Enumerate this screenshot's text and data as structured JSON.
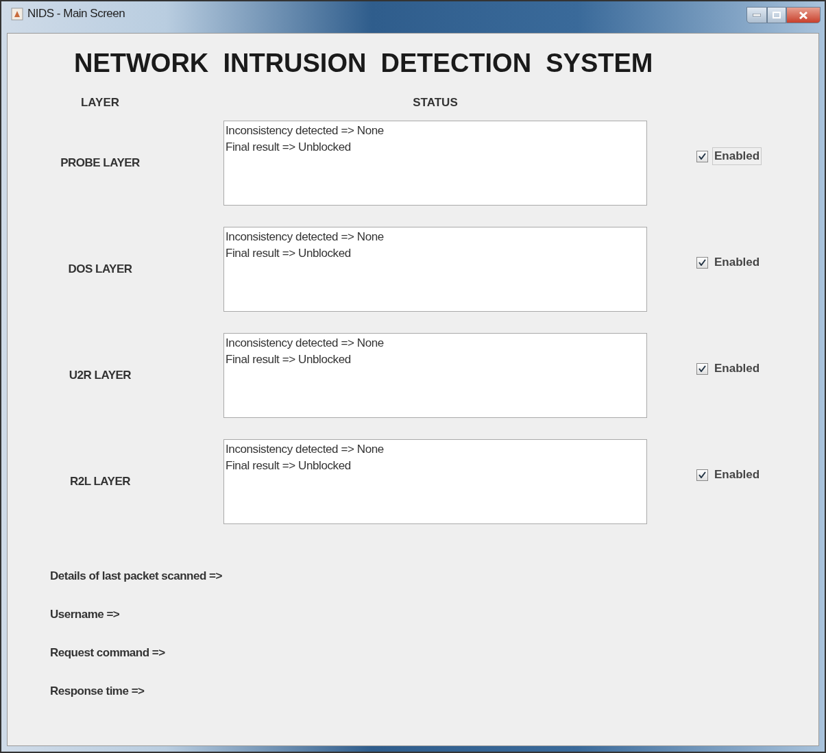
{
  "window": {
    "title": "NIDS - Main Screen"
  },
  "heading": "NETWORK  INTRUSION  DETECTION  SYSTEM",
  "columns": {
    "layer": "LAYER",
    "status": "STATUS"
  },
  "layers": [
    {
      "name": "PROBE LAYER",
      "status_lines": [
        "Inconsistency detected => None",
        "Final result => Unblocked"
      ],
      "checkbox": {
        "label": "Enabled",
        "checked": true,
        "focused": true
      }
    },
    {
      "name": "DOS LAYER",
      "status_lines": [
        "Inconsistency detected => None",
        "Final result => Unblocked"
      ],
      "checkbox": {
        "label": "Enabled",
        "checked": true,
        "focused": false
      }
    },
    {
      "name": "U2R LAYER",
      "status_lines": [
        "Inconsistency detected => None",
        "Final result => Unblocked"
      ],
      "checkbox": {
        "label": "Enabled",
        "checked": true,
        "focused": false
      }
    },
    {
      "name": "R2L LAYER",
      "status_lines": [
        "Inconsistency detected => None",
        "Final result => Unblocked"
      ],
      "checkbox": {
        "label": "Enabled",
        "checked": true,
        "focused": false
      }
    }
  ],
  "details": [
    "Details of last packet scanned =>",
    "Username =>",
    "Request command =>",
    "Response time =>"
  ]
}
